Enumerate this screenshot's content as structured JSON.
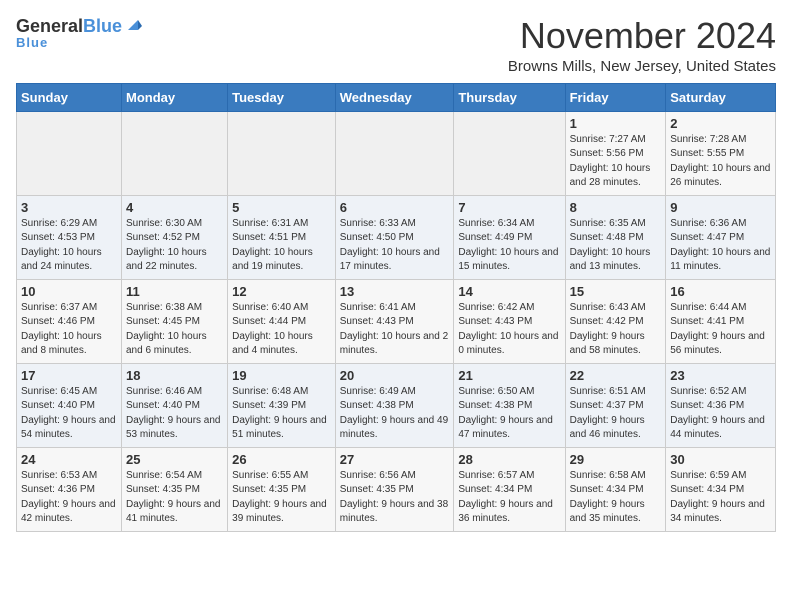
{
  "logo": {
    "general": "General",
    "blue": "Blue"
  },
  "title": "November 2024",
  "subtitle": "Browns Mills, New Jersey, United States",
  "days_of_week": [
    "Sunday",
    "Monday",
    "Tuesday",
    "Wednesday",
    "Thursday",
    "Friday",
    "Saturday"
  ],
  "weeks": [
    [
      {
        "day": "",
        "info": ""
      },
      {
        "day": "",
        "info": ""
      },
      {
        "day": "",
        "info": ""
      },
      {
        "day": "",
        "info": ""
      },
      {
        "day": "",
        "info": ""
      },
      {
        "day": "1",
        "info": "Sunrise: 7:27 AM\nSunset: 5:56 PM\nDaylight: 10 hours and 28 minutes."
      },
      {
        "day": "2",
        "info": "Sunrise: 7:28 AM\nSunset: 5:55 PM\nDaylight: 10 hours and 26 minutes."
      }
    ],
    [
      {
        "day": "3",
        "info": "Sunrise: 6:29 AM\nSunset: 4:53 PM\nDaylight: 10 hours and 24 minutes."
      },
      {
        "day": "4",
        "info": "Sunrise: 6:30 AM\nSunset: 4:52 PM\nDaylight: 10 hours and 22 minutes."
      },
      {
        "day": "5",
        "info": "Sunrise: 6:31 AM\nSunset: 4:51 PM\nDaylight: 10 hours and 19 minutes."
      },
      {
        "day": "6",
        "info": "Sunrise: 6:33 AM\nSunset: 4:50 PM\nDaylight: 10 hours and 17 minutes."
      },
      {
        "day": "7",
        "info": "Sunrise: 6:34 AM\nSunset: 4:49 PM\nDaylight: 10 hours and 15 minutes."
      },
      {
        "day": "8",
        "info": "Sunrise: 6:35 AM\nSunset: 4:48 PM\nDaylight: 10 hours and 13 minutes."
      },
      {
        "day": "9",
        "info": "Sunrise: 6:36 AM\nSunset: 4:47 PM\nDaylight: 10 hours and 11 minutes."
      }
    ],
    [
      {
        "day": "10",
        "info": "Sunrise: 6:37 AM\nSunset: 4:46 PM\nDaylight: 10 hours and 8 minutes."
      },
      {
        "day": "11",
        "info": "Sunrise: 6:38 AM\nSunset: 4:45 PM\nDaylight: 10 hours and 6 minutes."
      },
      {
        "day": "12",
        "info": "Sunrise: 6:40 AM\nSunset: 4:44 PM\nDaylight: 10 hours and 4 minutes."
      },
      {
        "day": "13",
        "info": "Sunrise: 6:41 AM\nSunset: 4:43 PM\nDaylight: 10 hours and 2 minutes."
      },
      {
        "day": "14",
        "info": "Sunrise: 6:42 AM\nSunset: 4:43 PM\nDaylight: 10 hours and 0 minutes."
      },
      {
        "day": "15",
        "info": "Sunrise: 6:43 AM\nSunset: 4:42 PM\nDaylight: 9 hours and 58 minutes."
      },
      {
        "day": "16",
        "info": "Sunrise: 6:44 AM\nSunset: 4:41 PM\nDaylight: 9 hours and 56 minutes."
      }
    ],
    [
      {
        "day": "17",
        "info": "Sunrise: 6:45 AM\nSunset: 4:40 PM\nDaylight: 9 hours and 54 minutes."
      },
      {
        "day": "18",
        "info": "Sunrise: 6:46 AM\nSunset: 4:40 PM\nDaylight: 9 hours and 53 minutes."
      },
      {
        "day": "19",
        "info": "Sunrise: 6:48 AM\nSunset: 4:39 PM\nDaylight: 9 hours and 51 minutes."
      },
      {
        "day": "20",
        "info": "Sunrise: 6:49 AM\nSunset: 4:38 PM\nDaylight: 9 hours and 49 minutes."
      },
      {
        "day": "21",
        "info": "Sunrise: 6:50 AM\nSunset: 4:38 PM\nDaylight: 9 hours and 47 minutes."
      },
      {
        "day": "22",
        "info": "Sunrise: 6:51 AM\nSunset: 4:37 PM\nDaylight: 9 hours and 46 minutes."
      },
      {
        "day": "23",
        "info": "Sunrise: 6:52 AM\nSunset: 4:36 PM\nDaylight: 9 hours and 44 minutes."
      }
    ],
    [
      {
        "day": "24",
        "info": "Sunrise: 6:53 AM\nSunset: 4:36 PM\nDaylight: 9 hours and 42 minutes."
      },
      {
        "day": "25",
        "info": "Sunrise: 6:54 AM\nSunset: 4:35 PM\nDaylight: 9 hours and 41 minutes."
      },
      {
        "day": "26",
        "info": "Sunrise: 6:55 AM\nSunset: 4:35 PM\nDaylight: 9 hours and 39 minutes."
      },
      {
        "day": "27",
        "info": "Sunrise: 6:56 AM\nSunset: 4:35 PM\nDaylight: 9 hours and 38 minutes."
      },
      {
        "day": "28",
        "info": "Sunrise: 6:57 AM\nSunset: 4:34 PM\nDaylight: 9 hours and 36 minutes."
      },
      {
        "day": "29",
        "info": "Sunrise: 6:58 AM\nSunset: 4:34 PM\nDaylight: 9 hours and 35 minutes."
      },
      {
        "day": "30",
        "info": "Sunrise: 6:59 AM\nSunset: 4:34 PM\nDaylight: 9 hours and 34 minutes."
      }
    ]
  ]
}
